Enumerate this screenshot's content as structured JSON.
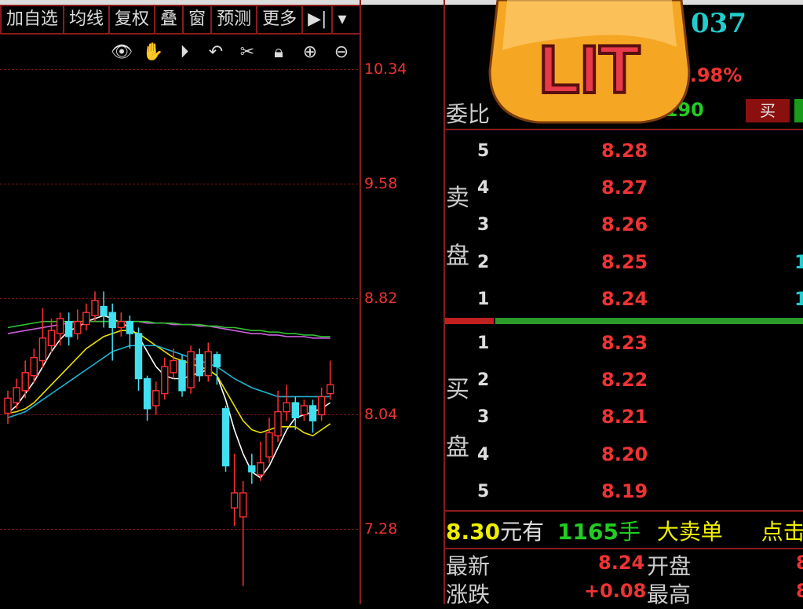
{
  "toolbar": {
    "items": [
      "加自选",
      "均线",
      "复权",
      "叠",
      "窗",
      "预测",
      "更多",
      "▶|",
      "▾"
    ]
  },
  "chart_icons": [
    "eye-icon",
    "hand-icon",
    "play-icon",
    "undo-icon",
    "scissors-icon",
    "lock-icon",
    "zoom-in-icon",
    "zoom-out-icon"
  ],
  "badge": {
    "text": "LIT"
  },
  "quote": {
    "code_suffix": "037",
    "change_pct": "0.98%",
    "weibi_label": "委比",
    "weibi_value": "4190",
    "buy_label": "买"
  },
  "order_book": {
    "sell_label": [
      "卖",
      "盘"
    ],
    "buy_label": [
      "买",
      "盘"
    ],
    "asks": [
      {
        "level": "5",
        "price": "8.28",
        "vol": ""
      },
      {
        "level": "4",
        "price": "8.27",
        "vol": ""
      },
      {
        "level": "3",
        "price": "8.26",
        "vol": ""
      },
      {
        "level": "2",
        "price": "8.25",
        "vol": "1"
      },
      {
        "level": "1",
        "price": "8.24",
        "vol": "1"
      }
    ],
    "bids": [
      {
        "level": "1",
        "price": "8.23"
      },
      {
        "level": "2",
        "price": "8.22"
      },
      {
        "level": "3",
        "price": "8.21"
      },
      {
        "level": "4",
        "price": "8.20"
      },
      {
        "level": "5",
        "price": "8.19"
      }
    ]
  },
  "big_order": {
    "price": "8.30",
    "unit1": "元有",
    "qty": "1165",
    "unit2": "手",
    "desc": "大卖单",
    "link": "点击查"
  },
  "stats": {
    "row1": {
      "l1": "最新",
      "v1": "8.24",
      "l2": "开盘",
      "v2": "8"
    },
    "row2": {
      "l1": "涨跌",
      "v1": "+0.08",
      "l2": "最高",
      "v2": "8"
    }
  },
  "chart_data": {
    "type": "candlestick",
    "y_ticks": [
      "10.34",
      "9.58",
      "8.82",
      "8.04",
      "7.28"
    ],
    "ylim": [
      7.0,
      10.6
    ],
    "candles": [
      {
        "o": 8.05,
        "c": 8.15,
        "h": 8.2,
        "l": 7.98
      },
      {
        "o": 8.12,
        "c": 8.22,
        "h": 8.28,
        "l": 8.08
      },
      {
        "o": 8.2,
        "c": 8.32,
        "h": 8.4,
        "l": 8.15
      },
      {
        "o": 8.3,
        "c": 8.42,
        "h": 8.48,
        "l": 8.25
      },
      {
        "o": 8.4,
        "c": 8.55,
        "h": 8.75,
        "l": 8.35
      },
      {
        "o": 8.5,
        "c": 8.6,
        "h": 8.68,
        "l": 8.45
      },
      {
        "o": 8.58,
        "c": 8.68,
        "h": 8.72,
        "l": 8.5
      },
      {
        "o": 8.66,
        "c": 8.56,
        "h": 8.72,
        "l": 8.5
      },
      {
        "o": 8.58,
        "c": 8.66,
        "h": 8.74,
        "l": 8.54
      },
      {
        "o": 8.64,
        "c": 8.72,
        "h": 8.78,
        "l": 8.6
      },
      {
        "o": 8.7,
        "c": 8.8,
        "h": 8.86,
        "l": 8.66
      },
      {
        "o": 8.76,
        "c": 8.7,
        "h": 8.86,
        "l": 8.62
      },
      {
        "o": 8.72,
        "c": 8.62,
        "h": 8.78,
        "l": 8.4
      },
      {
        "o": 8.62,
        "c": 8.66,
        "h": 8.72,
        "l": 8.56
      },
      {
        "o": 8.66,
        "c": 8.58,
        "h": 8.7,
        "l": 8.48
      },
      {
        "o": 8.58,
        "c": 8.28,
        "h": 8.62,
        "l": 8.2
      },
      {
        "o": 8.28,
        "c": 8.08,
        "h": 8.3,
        "l": 8.0
      },
      {
        "o": 8.1,
        "c": 8.2,
        "h": 8.26,
        "l": 8.04
      },
      {
        "o": 8.18,
        "c": 8.36,
        "h": 8.42,
        "l": 8.14
      },
      {
        "o": 8.32,
        "c": 8.4,
        "h": 8.48,
        "l": 8.28
      },
      {
        "o": 8.4,
        "c": 8.2,
        "h": 8.44,
        "l": 8.16
      },
      {
        "o": 8.22,
        "c": 8.46,
        "h": 8.5,
        "l": 8.18
      },
      {
        "o": 8.44,
        "c": 8.3,
        "h": 8.48,
        "l": 8.26
      },
      {
        "o": 8.3,
        "c": 8.46,
        "h": 8.52,
        "l": 8.26
      },
      {
        "o": 8.44,
        "c": 8.36,
        "h": 8.46,
        "l": 8.24
      },
      {
        "o": 8.08,
        "c": 7.7,
        "h": 8.1,
        "l": 7.66
      },
      {
        "o": 7.42,
        "c": 7.52,
        "h": 7.78,
        "l": 7.3
      },
      {
        "o": 7.36,
        "c": 7.52,
        "h": 7.6,
        "l": 6.9
      },
      {
        "o": 7.7,
        "c": 7.66,
        "h": 7.78,
        "l": 7.58
      },
      {
        "o": 7.64,
        "c": 7.72,
        "h": 7.86,
        "l": 7.6
      },
      {
        "o": 7.76,
        "c": 7.92,
        "h": 8.02,
        "l": 7.72
      },
      {
        "o": 7.9,
        "c": 8.06,
        "h": 8.2,
        "l": 7.86
      },
      {
        "o": 8.06,
        "c": 8.12,
        "h": 8.24,
        "l": 8.0
      },
      {
        "o": 8.12,
        "c": 8.02,
        "h": 8.16,
        "l": 7.94
      },
      {
        "o": 8.04,
        "c": 8.1,
        "h": 8.14,
        "l": 8.0
      },
      {
        "o": 8.1,
        "c": 8.0,
        "h": 8.14,
        "l": 7.92
      },
      {
        "o": 8.04,
        "c": 8.16,
        "h": 8.22,
        "l": 8.0
      },
      {
        "o": 8.18,
        "c": 8.24,
        "h": 8.4,
        "l": 8.14
      }
    ],
    "ma_lines": [
      {
        "color": "#ffffff",
        "values": [
          8.05,
          8.1,
          8.18,
          8.26,
          8.36,
          8.46,
          8.54,
          8.6,
          8.62,
          8.66,
          8.68,
          8.7,
          8.68,
          8.65,
          8.62,
          8.56,
          8.46,
          8.36,
          8.3,
          8.28,
          8.28,
          8.3,
          8.32,
          8.34,
          8.3,
          8.14,
          7.94,
          7.78,
          7.66,
          7.62,
          7.7,
          7.82,
          7.94,
          8.02,
          8.04,
          8.06,
          8.08,
          8.12
        ]
      },
      {
        "color": "#e8e000",
        "values": [
          8.05,
          8.06,
          8.08,
          8.12,
          8.18,
          8.24,
          8.3,
          8.36,
          8.42,
          8.48,
          8.52,
          8.56,
          8.58,
          8.6,
          8.6,
          8.58,
          8.54,
          8.5,
          8.46,
          8.42,
          8.4,
          8.38,
          8.36,
          8.34,
          8.3,
          8.2,
          8.1,
          8.0,
          7.94,
          7.92,
          7.94,
          7.96,
          7.96,
          7.96,
          7.92,
          7.9,
          7.94,
          7.98
        ]
      },
      {
        "color": "#d060e0",
        "values": [
          8.58,
          8.59,
          8.6,
          8.61,
          8.62,
          8.63,
          8.64,
          8.65,
          8.66,
          8.66,
          8.66,
          8.66,
          8.66,
          8.66,
          8.66,
          8.66,
          8.65,
          8.65,
          8.65,
          8.64,
          8.64,
          8.64,
          8.63,
          8.63,
          8.62,
          8.61,
          8.6,
          8.59,
          8.58,
          8.58,
          8.57,
          8.57,
          8.56,
          8.56,
          8.56,
          8.55,
          8.55,
          8.55
        ]
      },
      {
        "color": "#30c030",
        "values": [
          8.62,
          8.63,
          8.64,
          8.65,
          8.66,
          8.66,
          8.66,
          8.66,
          8.66,
          8.66,
          8.66,
          8.66,
          8.66,
          8.66,
          8.66,
          8.66,
          8.66,
          8.65,
          8.65,
          8.65,
          8.64,
          8.64,
          8.64,
          8.63,
          8.63,
          8.62,
          8.62,
          8.61,
          8.6,
          8.6,
          8.59,
          8.59,
          8.58,
          8.58,
          8.57,
          8.57,
          8.56,
          8.56
        ]
      },
      {
        "color": "#20b0d0",
        "values": [
          8.02,
          8.04,
          8.06,
          8.1,
          8.14,
          8.18,
          8.22,
          8.26,
          8.3,
          8.34,
          8.38,
          8.42,
          8.46,
          8.48,
          8.5,
          8.5,
          8.5,
          8.5,
          8.48,
          8.46,
          8.44,
          8.42,
          8.4,
          8.38,
          8.36,
          8.32,
          8.28,
          8.25,
          8.22,
          8.2,
          8.18,
          8.16,
          8.16,
          8.16,
          8.16,
          8.16,
          8.16,
          8.16
        ]
      }
    ]
  }
}
